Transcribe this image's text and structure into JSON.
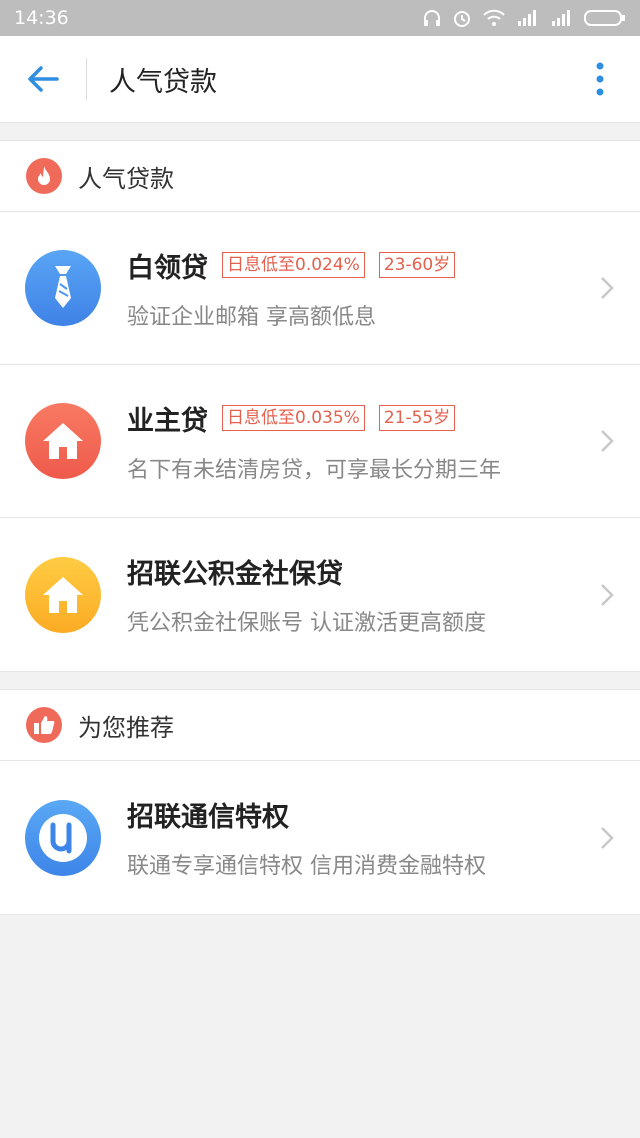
{
  "status_bar": {
    "time": "14:36"
  },
  "app_bar": {
    "title": "人气贷款"
  },
  "sections": [
    {
      "title": "人气贷款",
      "icon": "flame-icon",
      "items": [
        {
          "title": "白领贷",
          "tags": [
            "日息低至0.024%",
            "23-60岁"
          ],
          "desc": "验证企业邮箱 享高额低息",
          "icon": "tie-icon",
          "icon_color_top": "#59a5f5",
          "icon_color_bottom": "#3f82e6"
        },
        {
          "title": "业主贷",
          "tags": [
            "日息低至0.035%",
            "21-55岁"
          ],
          "desc": "名下有未结清房贷，可享最长分期三年",
          "icon": "house-icon",
          "icon_color_top": "#f97a63",
          "icon_color_bottom": "#ee5a4b"
        },
        {
          "title": "招联公积金社保贷",
          "tags": [],
          "desc": "凭公积金社保账号 认证激活更高额度",
          "icon": "house-icon",
          "icon_color_top": "#ffcc44",
          "icon_color_bottom": "#fbab24"
        }
      ]
    },
    {
      "title": "为您推荐",
      "icon": "thumbs-up-icon",
      "items": [
        {
          "title": "招联通信特权",
          "tags": [],
          "desc": "联通专享通信特权 信用消费金融特权",
          "icon": "unicom-u-icon",
          "icon_color_top": "#5aa8f5",
          "icon_color_bottom": "#3d85e8"
        }
      ]
    }
  ]
}
